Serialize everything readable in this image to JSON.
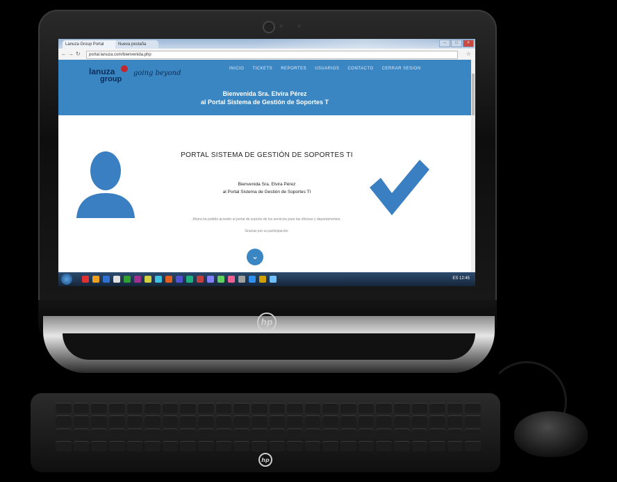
{
  "browser": {
    "tabs": [
      "Lanuza Group Portal",
      "Nueva pestaña"
    ],
    "url": "portal.lanuza.com/bienvenida.php",
    "window_buttons": [
      "–",
      "□",
      "×"
    ]
  },
  "site": {
    "logo_text_1": "lanuza",
    "logo_text_2": "group",
    "logo_signature": "going beyond",
    "menu": [
      "INICIO",
      "TICKETS",
      "REPORTES",
      "USUARIOS",
      "CONTACTO",
      "CERRAR SESION"
    ],
    "welcome_line1": "Bienvenida Sra. Elvira Pérez",
    "welcome_line2": "al Portal Sistema de Gestión de Soportes T"
  },
  "main": {
    "title": "PORTAL SISTEMA DE GESTIÓN DE SOPORTES TI",
    "sub1": "Bienvenida Sra. Elvira Pérez",
    "sub2": "al Portal Sistema de Gestión de Soportes TI",
    "desc1": "Ahora ha podido acceder al portal de soporte de los servicios para las oficinas y departamentos.",
    "desc2": "Gracias por su participación."
  },
  "taskbar": {
    "tray_text": "ES  12:45",
    "icon_colors": [
      "#e03030",
      "#f0a020",
      "#3070d0",
      "#e0e0e0",
      "#30a030",
      "#a03090",
      "#d0d040",
      "#40c0e0",
      "#e06020",
      "#5050d0",
      "#20b080",
      "#c04040",
      "#8080ff",
      "#60d060",
      "#f06090",
      "#a0a0a0",
      "#3090f0",
      "#d0a000",
      "#70c0ff"
    ]
  },
  "device": {
    "brand": "hp"
  }
}
